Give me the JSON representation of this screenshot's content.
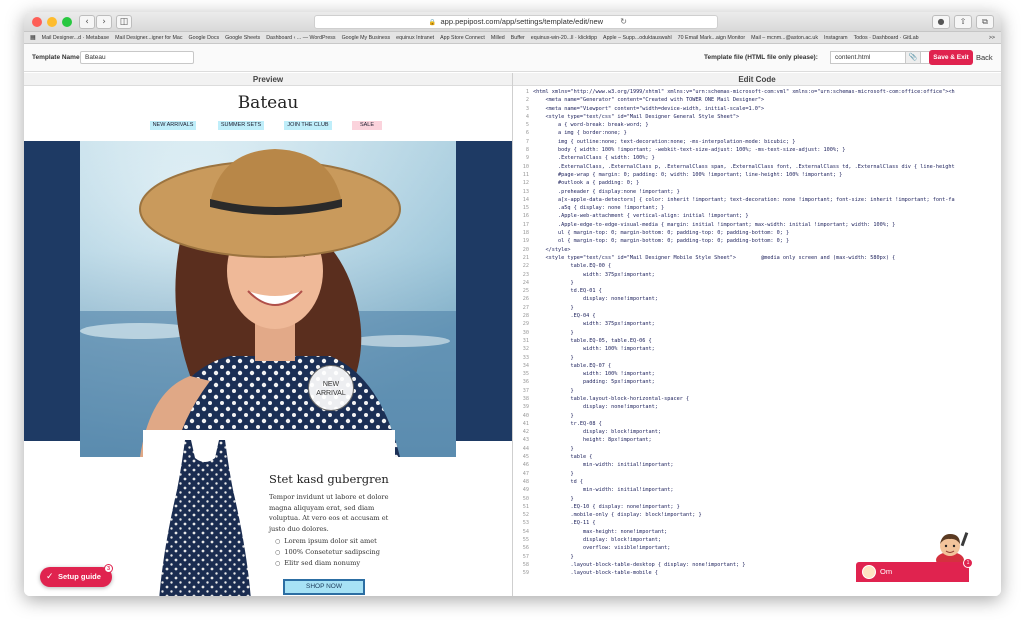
{
  "browser": {
    "url": "app.pepipost.com/app/settings/template/edit/new",
    "bookmarks": [
      "Mail Designer...d · Metabase",
      "Mail Designer...igner for Mac",
      "Google Docs",
      "Google Sheets",
      "Dashboard ‹ ... — WordPress",
      "Google My Business",
      "equinux Intranet",
      "App Store Connect",
      "Milled",
      "Buffer",
      "equinux-win-20...ll · klicktipp",
      "Apple – Supp...oduktauswahl",
      "70 Email Mark...aign Monitor",
      "Mail – mcnm...@aston.ac.uk",
      "Instagram",
      "Todos · Dashboard · GitLab"
    ],
    "bookmarks_more": ">>"
  },
  "toolbar": {
    "template_name_label": "Template Name:",
    "template_name_value": "Bateau",
    "template_file_label": "Template file (HTML file only please):",
    "template_file_value": "content.html",
    "save_exit_label": "Save & Exit",
    "back_label": "Back"
  },
  "preview": {
    "header": "Preview",
    "brand": "Bateau",
    "nav": [
      {
        "label": "NEW ARRIVALS",
        "color": "#bfeefa"
      },
      {
        "label": "SUMMER SETS",
        "color": "#bfeefa"
      },
      {
        "label": "JOIN THE CLUB",
        "color": "#bfeefa"
      },
      {
        "label": "SALE",
        "color": "#fbd3dc"
      }
    ],
    "badge_line1": "NEW",
    "badge_line2": "ARRIVAL",
    "card_title": "Stet kasd gubergren",
    "card_body": "Tempor invidunt ut labore et dolore magna aliquyam erat, sed diam voluptua. At vero eos et accusam et justo duo dolores.",
    "card_list": [
      "Lorem ipsum dolor sit amet",
      "100% Consetetur sadipscing",
      "Elitr sed diam nonumy"
    ],
    "shop_button": "SHOP NOW",
    "setup_guide": "Setup guide",
    "setup_count": "3"
  },
  "editor": {
    "header": "Edit Code",
    "lines": [
      "<html xmlns=\"http://www.w3.org/1999/xhtml\" xmlns:v=\"urn:schemas-microsoft-com:vml\" xmlns:o=\"urn:schemas-microsoft-com:office:office\"><h",
      "    <meta name=\"Generator\" content=\"Created with TOWER ONE Mail Designer\">",
      "    <meta name=\"Viewport\" content=\"width=device-width, initial-scale=1.0\">",
      "    <style type=\"text/css\" id=\"Mail Designer General Style Sheet\">",
      "        a { word-break: break-word; }",
      "        a img { border:none; }",
      "        img { outline:none; text-decoration:none; -ms-interpolation-mode: bicubic; }",
      "        body { width: 100% !important; -webkit-text-size-adjust: 100%; -ms-text-size-adjust: 100%; }",
      "        .ExternalClass { width: 100%; }",
      "        .ExternalClass, .ExternalClass p, .ExternalClass span, .ExternalClass font, .ExternalClass td, .ExternalClass div { line-height",
      "        #page-wrap { margin: 0; padding: 0; width: 100% !important; line-height: 100% !important; }",
      "        #outlook a { padding: 0; }",
      "        .preheader { display:none !important; }",
      "        a[x-apple-data-detectors] { color: inherit !important; text-decoration: none !important; font-size: inherit !important; font-fa",
      "        .a5q { display: none !important; }",
      "        .Apple-web-attachment { vertical-align: initial !important; }",
      "        .Apple-edge-to-edge-visual-media { margin: initial !important; max-width: initial !important; width: 100%; }",
      "        ul { margin-top: 0; margin-bottom: 0; padding-top: 0; padding-bottom: 0; }",
      "        ol { margin-top: 0; margin-bottom: 0; padding-top: 0; padding-bottom: 0; }",
      "    </style>",
      "    <style type=\"text/css\" id=\"Mail Designer Mobile Style Sheet\">        @media only screen and (max-width: 580px) {",
      "            table.EQ-00 {",
      "                width: 375px!important;",
      "            }",
      "            td.EQ-01 {",
      "                display: none!important;",
      "            }",
      "            .EQ-04 {",
      "                width: 375px!important;",
      "            }",
      "            table.EQ-05, table.EQ-06 {",
      "                width: 100% !important;",
      "            }",
      "            table.EQ-07 {",
      "                width: 100% !important;",
      "                padding: 5px!important;",
      "            }",
      "            table.layout-block-horizontal-spacer {",
      "                display: none!important;",
      "            }",
      "            tr.EQ-08 {",
      "                display: block!important;",
      "                height: 8px!important;",
      "            }",
      "            table {",
      "                min-width: initial!important;",
      "            }",
      "            td {",
      "                min-width: initial!important;",
      "            }",
      "            .EQ-10 { display: none!important; }",
      "            .mobile-only { display: block!important; }",
      "            .EQ-11 {",
      "                max-height: none!important;",
      "                display: block!important;",
      "                overflow: visible!important;",
      "            }",
      "            .layout-block-table-desktop { display: none!important; }",
      "            .layout-block-table-mobile {"
    ]
  },
  "chat": {
    "label": "Om",
    "badge": "1"
  }
}
